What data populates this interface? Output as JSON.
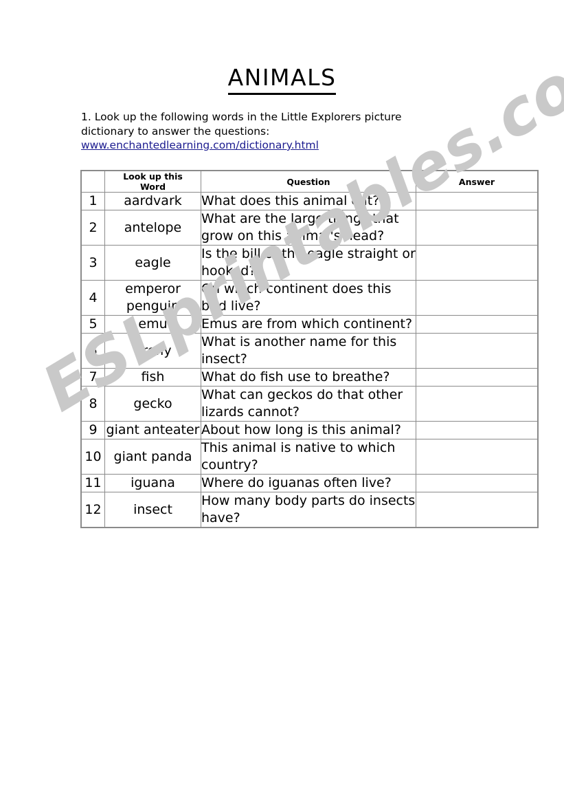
{
  "document": {
    "title": "ANIMALS",
    "watermark": "ESLprintables.com",
    "watermark_color": "#c9c9c9",
    "link_color": "#1b1b8f"
  },
  "instructions": {
    "line1": "1. Look up the following words in the Little Explorers picture",
    "line2": "dictionary to answer the questions:",
    "url": "www.enchantedlearning.com/dictionary.html"
  },
  "table": {
    "headers": {
      "number": "",
      "word_line1": "Look up this",
      "word_line2": "Word",
      "question": "Question",
      "answer": "Answer"
    },
    "rows": [
      {
        "num": "1",
        "word": "aardvark",
        "question": "What does this animal eat?",
        "answer": ""
      },
      {
        "num": "2",
        "word": "antelope",
        "question": "What are the large things that grow on this animal's head?",
        "answer": ""
      },
      {
        "num": "3",
        "word": "eagle",
        "question": "Is the bill of the eagle straight or hooked?",
        "answer": ""
      },
      {
        "num": "4",
        "word": "emperor penguin",
        "question": "On which continent does this bird live?",
        "answer": ""
      },
      {
        "num": "5",
        "word": "emu",
        "question": "Emus are from which continent?",
        "answer": ""
      },
      {
        "num": "6",
        "word": "firefly",
        "question": "What is another name for this insect?",
        "answer": ""
      },
      {
        "num": "7",
        "word": "fish",
        "question": "What do fish use to breathe?",
        "answer": ""
      },
      {
        "num": "8",
        "word": "gecko",
        "question": "What can geckos do that other lizards cannot?",
        "answer": ""
      },
      {
        "num": "9",
        "word": "giant anteater",
        "question": "About how long is this animal?",
        "answer": ""
      },
      {
        "num": "10",
        "word": "giant panda",
        "question": "This animal is native to which country?",
        "answer": ""
      },
      {
        "num": "11",
        "word": "iguana",
        "question": "Where do iguanas often live?",
        "answer": ""
      },
      {
        "num": "12",
        "word": "insect",
        "question": "How many body parts do insects have?",
        "answer": ""
      }
    ]
  }
}
